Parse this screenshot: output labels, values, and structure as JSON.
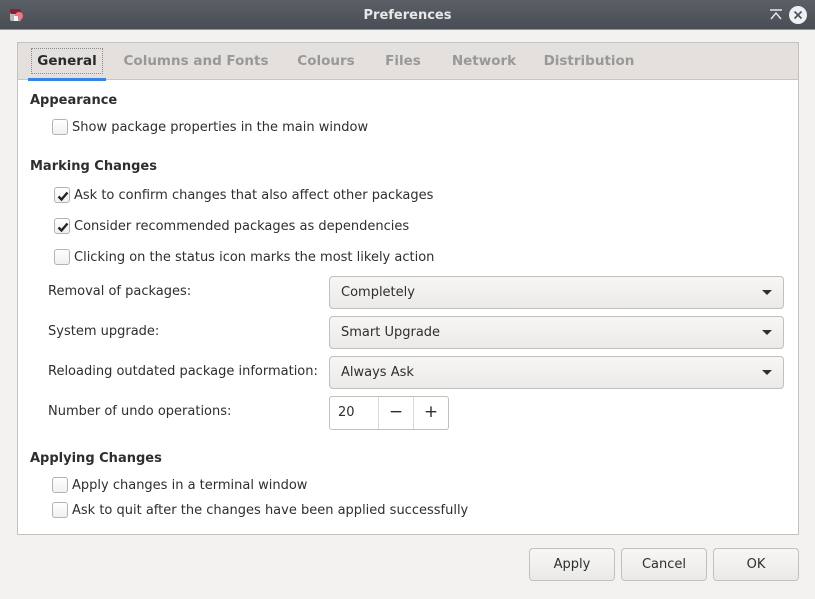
{
  "window": {
    "title": "Preferences",
    "icons": {
      "app": "package-manager-icon",
      "keep_above": "keep-above-icon",
      "close": "close-icon"
    }
  },
  "tabs": [
    {
      "label": "General",
      "active": true
    },
    {
      "label": "Columns and Fonts",
      "active": false
    },
    {
      "label": "Colours",
      "active": false
    },
    {
      "label": "Files",
      "active": false
    },
    {
      "label": "Network",
      "active": false
    },
    {
      "label": "Distribution",
      "active": false
    }
  ],
  "appearance": {
    "title": "Appearance",
    "show_properties": {
      "label": "Show package properties in the main window",
      "checked": false
    }
  },
  "marking": {
    "title": "Marking Changes",
    "ask_confirm": {
      "label": "Ask to confirm changes that also affect other packages",
      "checked": true
    },
    "recommended_deps": {
      "label": "Consider recommended packages as dependencies",
      "checked": true
    },
    "status_icon": {
      "label": "Clicking on the status icon marks the most likely action",
      "checked": false
    },
    "removal": {
      "label": "Removal of packages:",
      "value": "Completely"
    },
    "upgrade": {
      "label": "System upgrade:",
      "value": "Smart Upgrade"
    },
    "reloading": {
      "label": "Reloading outdated package information:",
      "value": "Always Ask"
    },
    "undo": {
      "label": "Number of undo operations:",
      "value": "20",
      "minus": "−",
      "plus": "+"
    }
  },
  "applying": {
    "title": "Applying Changes",
    "terminal": {
      "label": "Apply changes in a terminal window",
      "checked": false
    },
    "ask_quit": {
      "label": "Ask to quit after the changes have been applied successfully",
      "checked": false
    }
  },
  "buttons": {
    "apply": "Apply",
    "cancel": "Cancel",
    "ok": "OK"
  }
}
